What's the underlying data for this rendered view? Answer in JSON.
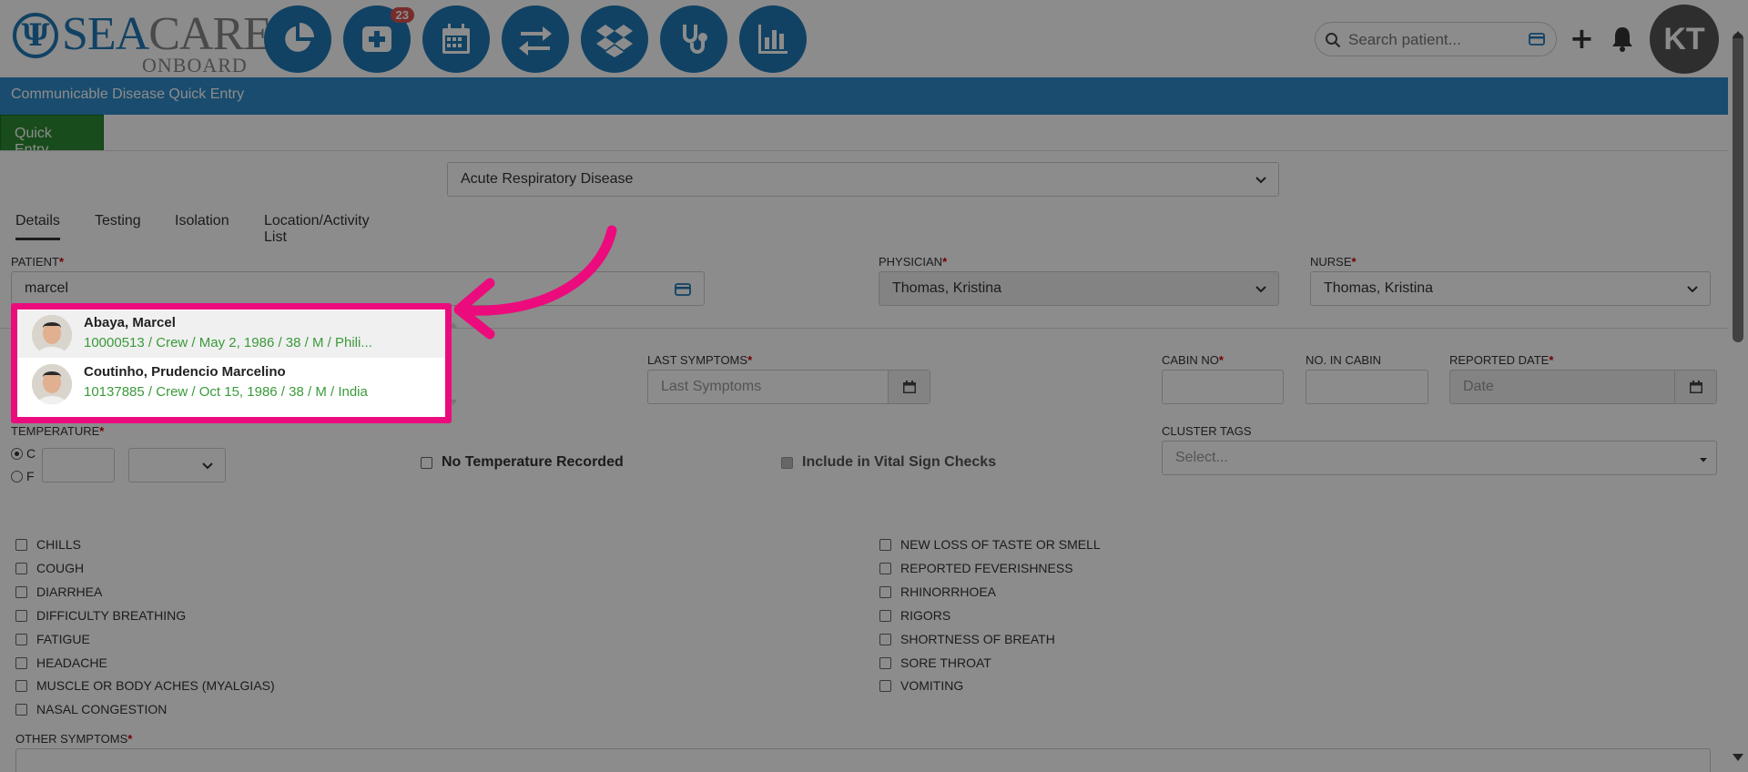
{
  "app": {
    "logo_sea": "SEA",
    "logo_care": "CARE",
    "logo_onboard": "ONBOARD",
    "nav_badge_count": "23",
    "search_placeholder": "Search patient...",
    "user_initials": "KT",
    "accent_color": "#1f78b4"
  },
  "nav_icons": [
    "pie-chart-icon",
    "medical-plus-icon",
    "calendar-icon",
    "transfer-arrows-icon",
    "dropbox-icon",
    "stethoscope-icon",
    "bar-chart-icon"
  ],
  "page": {
    "title": "Communicable Disease Quick Entry",
    "quick_entry_tab": "Quick Entry",
    "disease_select": "Acute Respiratory Disease"
  },
  "tabs": [
    "Details",
    "Testing",
    "Isolation",
    "Location/Activity List"
  ],
  "form": {
    "patient_label": "PATIENT",
    "patient_value": "marcel",
    "physician_label": "PHYSICIAN",
    "physician_value": "Thomas, Kristina",
    "nurse_label": "NURSE",
    "nurse_value": "Thomas, Kristina",
    "last_symptoms_label": "LAST SYMPTOMS",
    "last_symptoms_placeholder": "Last Symptoms",
    "cabin_no_label": "CABIN NO",
    "no_in_cabin_label": "NO. IN CABIN",
    "reported_date_label": "REPORTED DATE",
    "reported_date_placeholder": "Date",
    "temperature_label": "TEMPERATURE",
    "temp_c": "C",
    "temp_f": "F",
    "no_temp_label": "No Temperature Recorded",
    "vital_checks_label": "Include in Vital Sign Checks",
    "cluster_tags_label": "CLUSTER TAGS",
    "cluster_tags_placeholder": "Select...",
    "other_symptoms_label": "OTHER SYMPTOMS"
  },
  "symptoms_left": [
    "CHILLS",
    "COUGH",
    "DIARRHEA",
    "DIFFICULTY BREATHING",
    "FATIGUE",
    "HEADACHE",
    "MUSCLE OR BODY ACHES (MYALGIAS)",
    "NASAL CONGESTION"
  ],
  "symptoms_right": [
    "NEW LOSS OF TASTE OR SMELL",
    "REPORTED FEVERISHNESS",
    "RHINORRHOEA",
    "RIGORS",
    "SHORTNESS OF BREATH",
    "SORE THROAT",
    "VOMITING"
  ],
  "patient_results": [
    {
      "name": "Abaya, Marcel",
      "meta": "10000513 / Crew / May 2, 1986 / 38 / M / Phili..."
    },
    {
      "name": "Coutinho, Prudencio Marcelino",
      "meta": "10137885 / Crew / Oct 15, 1986 / 38 / M / India"
    }
  ],
  "highlight_color": "#ec0b7d"
}
